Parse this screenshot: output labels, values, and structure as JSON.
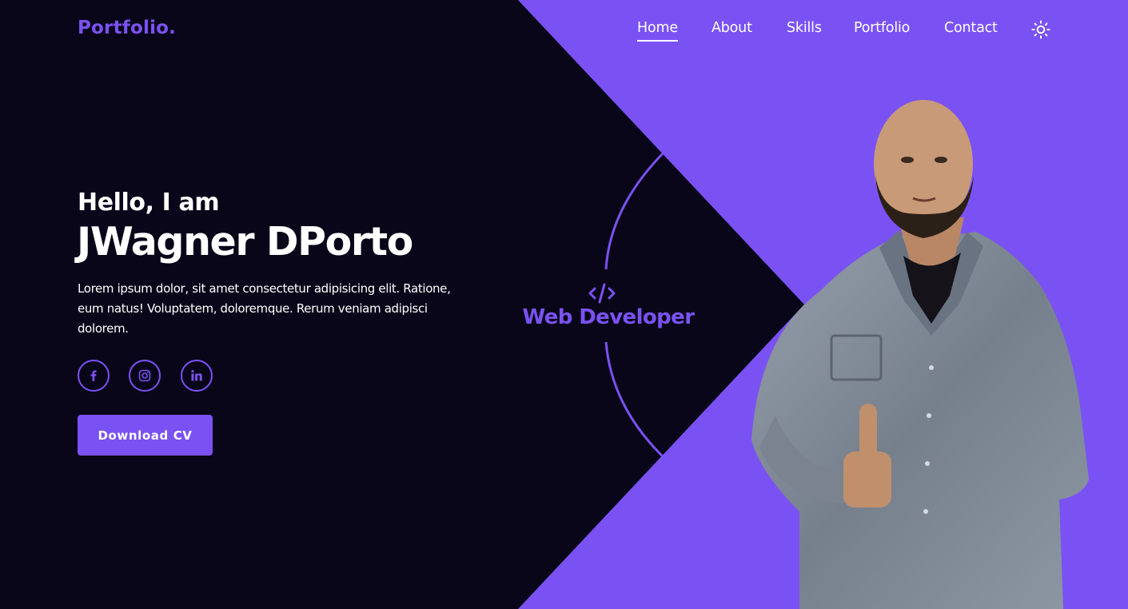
{
  "header": {
    "logo": "Portfolio.",
    "nav": [
      {
        "label": "Home",
        "active": true
      },
      {
        "label": "About",
        "active": false
      },
      {
        "label": "Skills",
        "active": false
      },
      {
        "label": "Portfolio",
        "active": false
      },
      {
        "label": "Contact",
        "active": false
      }
    ],
    "theme_toggle_icon": "sun-icon"
  },
  "hero": {
    "greeting": "Hello, I am",
    "name": "JWagner DPorto",
    "description": "Lorem ipsum dolor, sit amet consectetur adipisicing elit. Ratione, eum natus! Voluptatem, doloremque. Rerum veniam adipisci dolorem.",
    "socials": [
      {
        "icon": "facebook-icon"
      },
      {
        "icon": "instagram-icon"
      },
      {
        "icon": "linkedin-icon"
      }
    ],
    "cta_label": "Download CV",
    "role_icon": "code-icon",
    "role": "Web Developer"
  },
  "colors": {
    "background": "#0a0619",
    "accent": "#7a52f4",
    "text": "#ffffff"
  }
}
